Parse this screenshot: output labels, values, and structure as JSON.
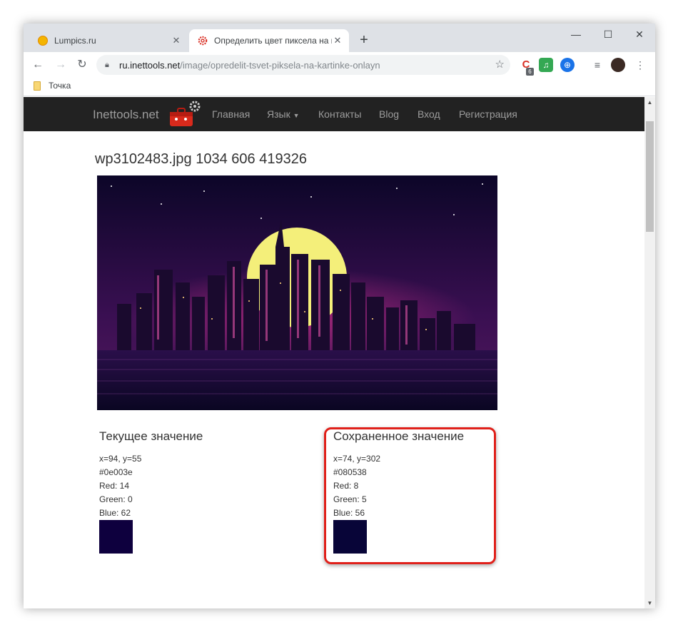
{
  "browser": {
    "tabs": [
      {
        "title": "Lumpics.ru",
        "active": false
      },
      {
        "title": "Определить цвет пиксела на ка",
        "active": true
      }
    ],
    "url_host": "ru.inettools.net",
    "url_path": "/image/opredelit-tsvet-piksela-na-kartinke-onlayn",
    "bookmark": "Точка",
    "extension_badge": "6"
  },
  "site": {
    "brand": "Inettools.net",
    "nav": [
      "Главная",
      "Язык",
      "Контакты",
      "Blog",
      "Вход",
      "Регистрация"
    ]
  },
  "page": {
    "title": "wp3102483.jpg 1034 606 419326"
  },
  "current": {
    "heading": "Текущее значение",
    "coords": "x=94, y=55",
    "hex": "#0e003e",
    "red": "Red: 14",
    "green": "Green: 0",
    "blue": "Blue: 62",
    "color": "#0e003e"
  },
  "saved": {
    "heading": "Сохраненное значение",
    "coords": "x=74, y=302",
    "hex": "#080538",
    "red": "Red: 8",
    "green": "Green: 5",
    "blue": "Blue: 56",
    "color": "#080538"
  },
  "colors": {
    "highlight": "#e0201a",
    "navbar": "#222222"
  },
  "icons": [
    "lumpics-favicon",
    "inettools-favicon",
    "back-icon",
    "forward-icon",
    "reload-icon",
    "lock-icon",
    "star-icon",
    "folder-icon",
    "toolbox-logo"
  ]
}
